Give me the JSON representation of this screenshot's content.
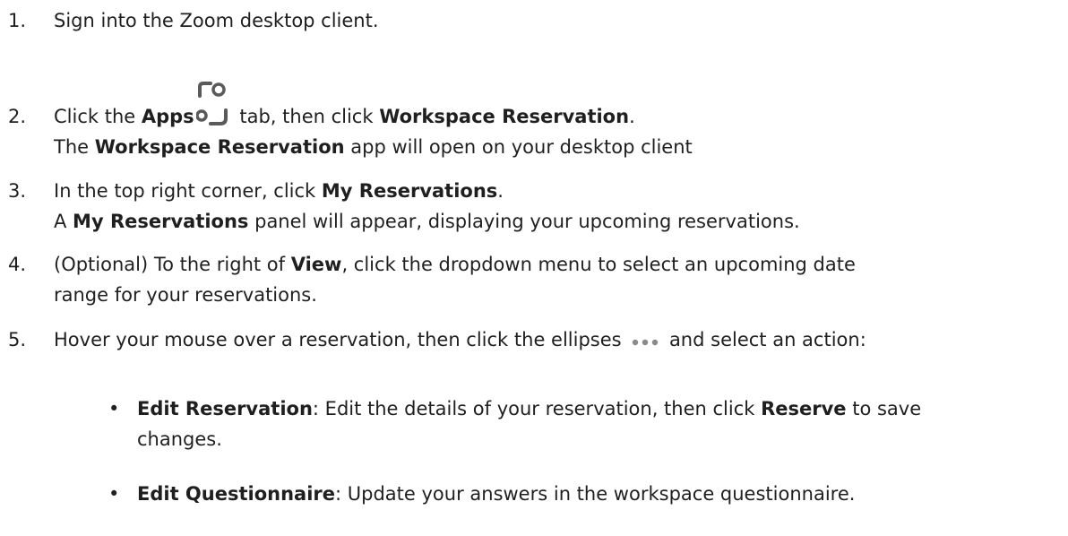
{
  "steps": [
    {
      "num": "1.",
      "parts": {
        "a": "Sign into the Zoom desktop client."
      }
    },
    {
      "num": "2.",
      "parts": {
        "a": "Click the ",
        "b": "Apps",
        "c": " tab, then click ",
        "d": "Workspace Reservation",
        "e": "."
      },
      "line2": {
        "a": "The ",
        "b": "Workspace Reservation",
        "c": " app will open on your desktop client"
      }
    },
    {
      "num": "3.",
      "parts": {
        "a": "In the top right corner, click ",
        "b": "My Reservations",
        "c": "."
      },
      "line2": {
        "a": "A ",
        "b": "My Reservations",
        "c": " panel will appear, displaying your upcoming reservations."
      }
    },
    {
      "num": "4.",
      "parts": {
        "a": "(Optional) To the right of ",
        "b": "View",
        "c": ", click the dropdown menu to select an upcoming date"
      },
      "line2": {
        "a": "range for your reservations."
      }
    },
    {
      "num": "5.",
      "parts": {
        "a": "Hover your mouse over a reservation, then click the ellipses ",
        "c": " and select an action:"
      }
    }
  ],
  "bullets": [
    {
      "dot": "•",
      "title": "Edit Reservation",
      "text": ": Edit the details of your reservation, then click ",
      "bold2": "Reserve",
      "text2": " to save",
      "line2": "changes."
    },
    {
      "dot": "•",
      "title": "Edit Questionnaire",
      "text": ": Update your answers in the workspace questionnaire."
    }
  ],
  "icons": {
    "apps": "apps-icon",
    "ellipses": "ellipsis-icon"
  },
  "colors": {
    "text": "#1f1f1f",
    "icon": "#5a5a5a",
    "dots": "#8a8a8a"
  }
}
